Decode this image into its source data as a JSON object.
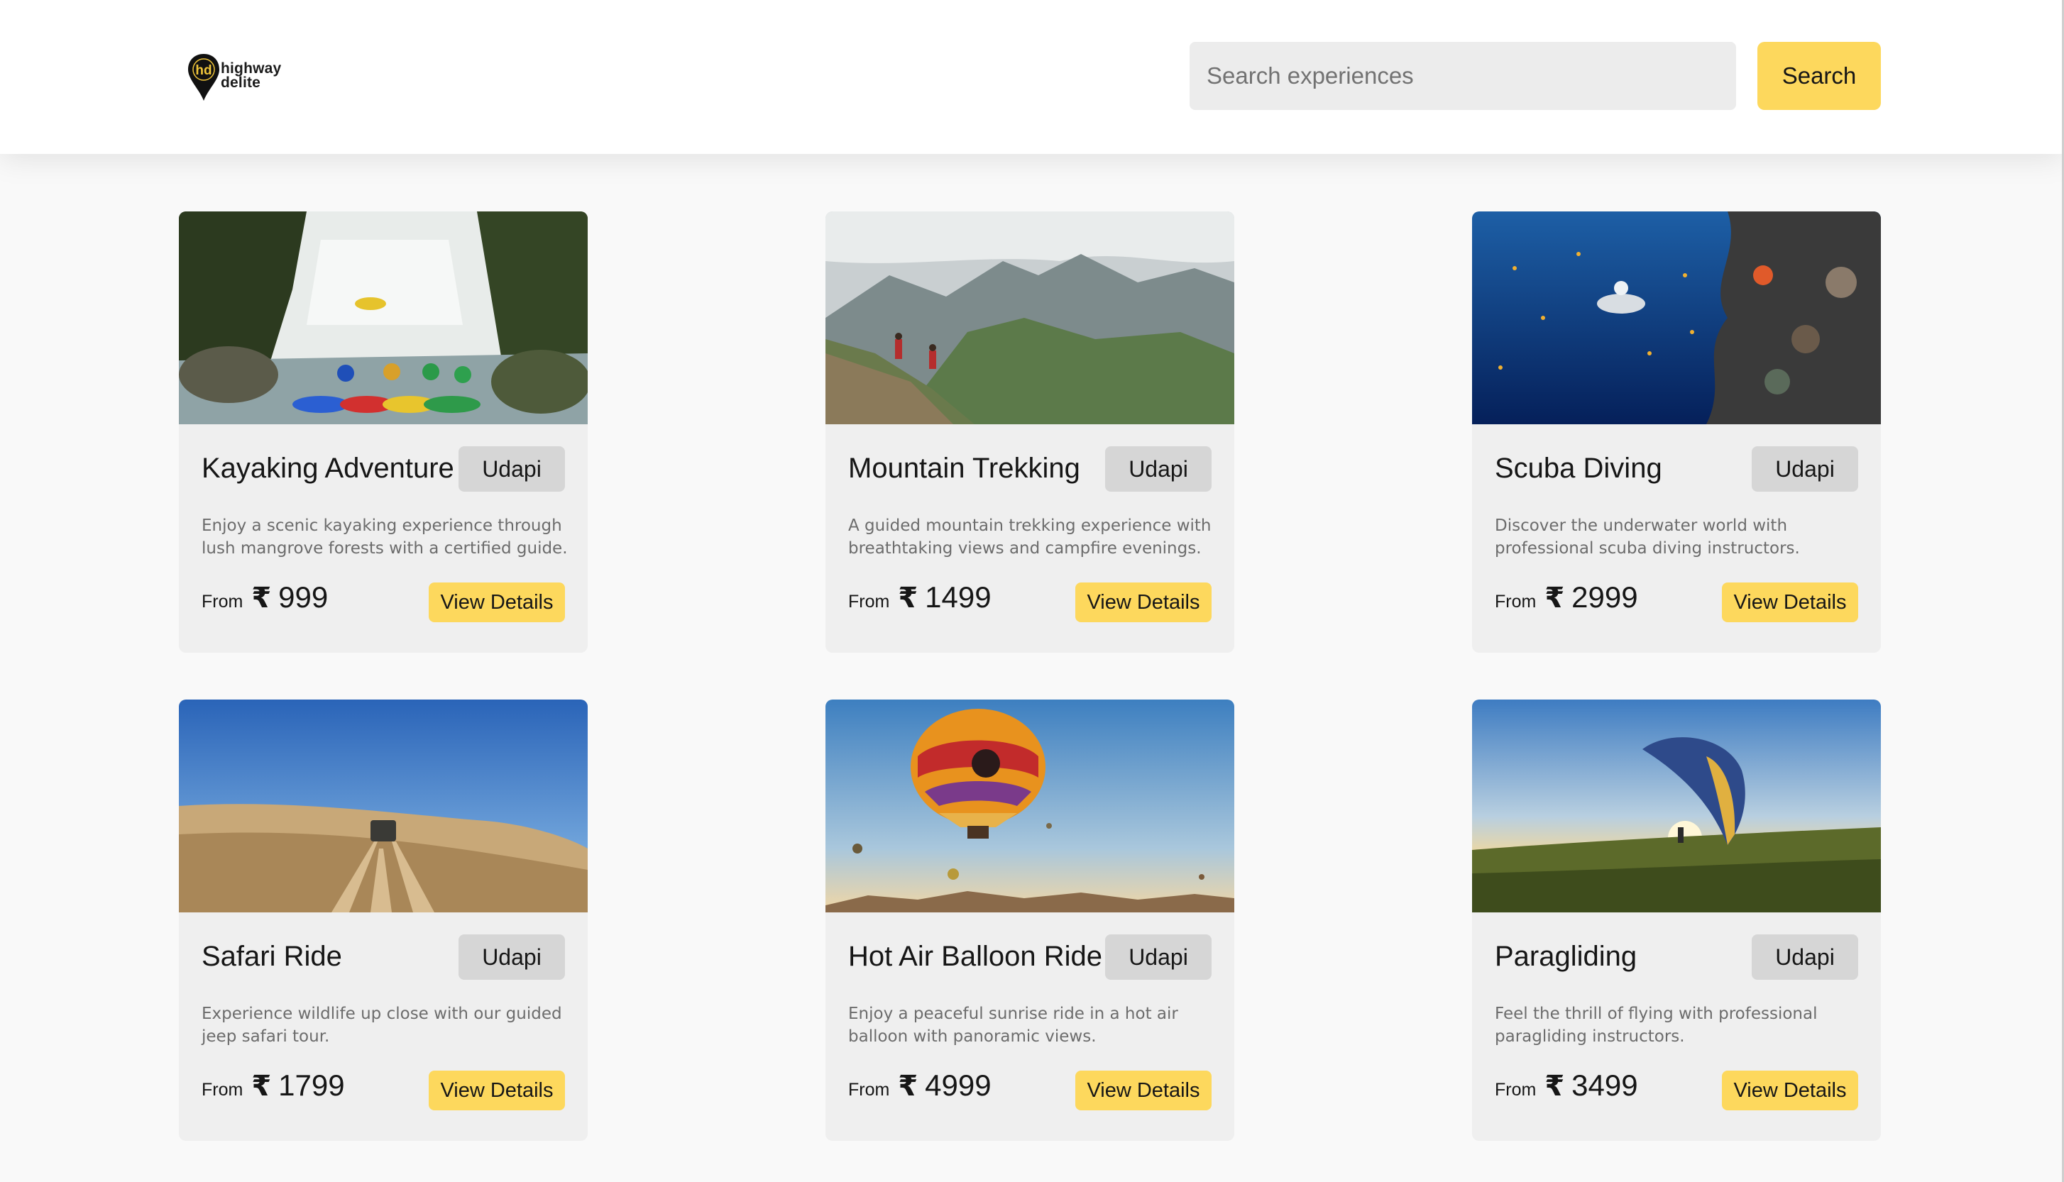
{
  "header": {
    "logo_line1": "highway",
    "logo_line2": "delite",
    "logo_mark": "hd",
    "search_placeholder": "Search experiences",
    "search_button": "Search"
  },
  "experiences": [
    {
      "title": "Kayaking Adventure",
      "location": "Udapi",
      "description": "Enjoy a scenic kayaking experience through lush mangrove forests with a certified guide.",
      "from_label": "From",
      "currency": "₹",
      "price": "999",
      "button": "View Details"
    },
    {
      "title": "Mountain Trekking",
      "location": "Udapi",
      "description": "A guided mountain trekking experience with breathtaking views and campfire evenings.",
      "from_label": "From",
      "currency": "₹",
      "price": "1499",
      "button": "View Details"
    },
    {
      "title": "Scuba Diving",
      "location": "Udapi",
      "description": "Discover the underwater world with professional scuba diving instructors.",
      "from_label": "From",
      "currency": "₹",
      "price": "2999",
      "button": "View Details"
    },
    {
      "title": "Safari Ride",
      "location": "Udapi",
      "description": "Experience wildlife up close with our guided jeep safari tour.",
      "from_label": "From",
      "currency": "₹",
      "price": "1799",
      "button": "View Details"
    },
    {
      "title": "Hot Air Balloon Ride",
      "location": "Udapi",
      "description": "Enjoy a peaceful sunrise ride in a hot air balloon with panoramic views.",
      "from_label": "From",
      "currency": "₹",
      "price": "4999",
      "button": "View Details"
    },
    {
      "title": "Paragliding",
      "location": "Udapi",
      "description": "Feel the thrill of flying with professional paragliding instructors.",
      "from_label": "From",
      "currency": "₹",
      "price": "3499",
      "button": "View Details"
    }
  ],
  "colors": {
    "accent": "#fdd85d",
    "card_bg": "#efefef",
    "badge_bg": "#d6d6d6",
    "page_bg": "#f9f9f9"
  }
}
